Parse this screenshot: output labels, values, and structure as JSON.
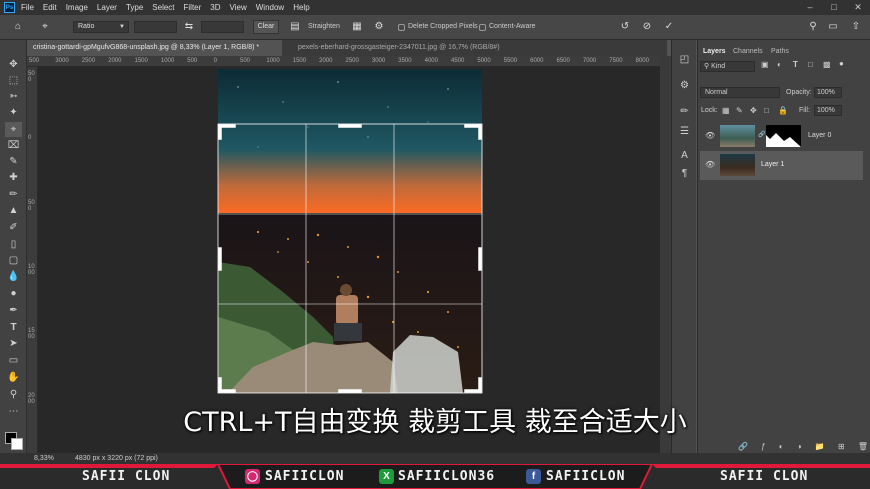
{
  "app": {
    "logo": "Ps"
  },
  "menu": [
    "File",
    "Edit",
    "Image",
    "Layer",
    "Type",
    "Select",
    "Filter",
    "3D",
    "View",
    "Window",
    "Help"
  ],
  "window_controls": [
    "–",
    "□",
    "✕"
  ],
  "options_bar": {
    "ratio_value": "Ratio",
    "clear_label": "Clear",
    "straighten_label": "Straighten",
    "delete_cropped_label": "Delete Cropped Pixels",
    "content_aware_label": "Content-Aware",
    "icons": [
      "home-icon",
      "crop-tool-icon",
      "swap-icon",
      "straighten-icon",
      "grid-overlay-icon",
      "gear-icon",
      "reset-icon",
      "cancel-icon",
      "commit-icon",
      "search-icon",
      "workspace-icon",
      "share-icon"
    ]
  },
  "tabs": [
    {
      "label": "cristina-gottardi-gpMgufvG868-unsplash.jpg @ 8,33% (Layer 1, RGB/8) *",
      "active": true
    },
    {
      "label": "pexels-eberhard-grossgasteiger-2347011.jpg @ 16,7% (RGB/8#)",
      "active": false
    }
  ],
  "ruler": {
    "h_ticks": [
      "500",
      "3000",
      "2500",
      "2000",
      "1500",
      "1000",
      "500",
      "0",
      "500",
      "1000",
      "1500",
      "2000",
      "2500",
      "3000",
      "3500",
      "4000",
      "4500",
      "5000",
      "5500",
      "6000",
      "6500",
      "7000",
      "7500",
      "8000"
    ],
    "v_ticks": [
      "500",
      "0",
      "500",
      "1000",
      "1500",
      "2000"
    ]
  },
  "layers_panel": {
    "tabs": [
      "Layers",
      "Channels",
      "Paths"
    ],
    "kind_label": "Kind",
    "blend_mode": "Normal",
    "opacity_label": "Opacity:",
    "opacity_value": "100%",
    "lock_label": "Lock:",
    "fill_label": "Fill:",
    "fill_value": "100%",
    "layers": [
      {
        "name": "Layer 0",
        "selected": false,
        "has_mask": true
      },
      {
        "name": "Layer 1",
        "selected": true,
        "has_mask": false
      }
    ]
  },
  "status": {
    "zoom": "8,33%",
    "doc_size": "4830 px x 3220 px (72 ppi)"
  },
  "subtitle": "CTRL+T自由变换 裁剪工具 裁至合适大小",
  "banner": {
    "left_name": "SAFII CLON",
    "instagram": "SAFIICLON",
    "xbox": "SAFIICLON36",
    "facebook": "SAFIICLON",
    "right_name": "SAFII CLON",
    "accent": "#e0183a"
  }
}
